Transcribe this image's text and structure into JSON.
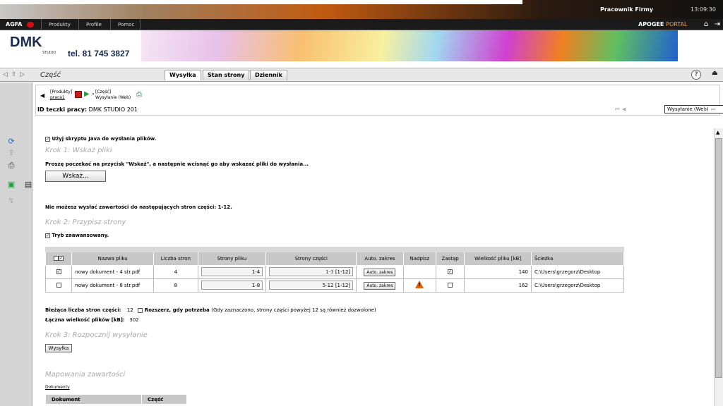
{
  "topbar": {
    "user": "Pracownik Firmy",
    "clock": "13:09:30"
  },
  "menubar": {
    "brand": "AGFA",
    "items": [
      "Produkty",
      "Profile",
      "Pomoc"
    ],
    "portal_main": "APOGEE",
    "portal_sub": "PORTAL",
    "icons": [
      "home-icon",
      "logout-icon"
    ]
  },
  "banner": {
    "logo": "DMK",
    "logo_sub": "STUDIO",
    "phone": "tel. 81 745 3827"
  },
  "tabs_row": {
    "title": "Część",
    "tabs": [
      "Wysyłka",
      "Stan strony",
      "Dziennik"
    ],
    "active": "Wysyłka",
    "help": "?"
  },
  "info": {
    "breadcrumb_1_top": "[Produkty]",
    "breadcrumb_1_bottom": "praca1",
    "breadcrumb_2_top": "[Część]",
    "breadcrumb_2_bottom": "Wysyłanie (Web)",
    "job_id_label": "ID teczki pracy:",
    "job_id_value": "DMK STUDIO 201",
    "dropdown_value": "Wysyłanie (Web)"
  },
  "main": {
    "java_label": "Użyj skryptu Java do wysłania plików.",
    "step1": "Krok 1: Wskaż pliki",
    "step1_instructions": "Proszę poczekać na przycisk \"Wskaż\", a następnie wcisnąć go aby wskazać pliki do wysłania...",
    "browse_button": "Wskaż...",
    "cannot_send": "Nie możesz wysłać zawartości do następujących stron części: 1-12.",
    "step2": "Krok 2: Przypisz strony",
    "advanced_label": "Tryb zaawansowany.",
    "table_headers": [
      "",
      "Nazwa pliku",
      "Liczba stron",
      "Strony pliku",
      "Strony części",
      "Auto. zakres",
      "Nadpisz",
      "Zastąp",
      "Wielkość pliku [kB]",
      "Ścieżka"
    ],
    "rows": [
      {
        "checked": true,
        "name": "nowy dokument - 4 str.pdf",
        "pages": "4",
        "file_pages": "1-4",
        "part_pages": "1-3",
        "part_range": "[1-12]",
        "auto": "Auto. zakres",
        "overwrite_warning": false,
        "replace": true,
        "size": "140",
        "path": "C:\\Users\\grzegorz\\Desktop"
      },
      {
        "checked": false,
        "name": "nowy dokument - 8 str.pdf",
        "pages": "8",
        "file_pages": "1-8",
        "part_pages": "5-12",
        "part_range": "[1-12]",
        "auto": "Auto. zakres",
        "overwrite_warning": true,
        "replace": false,
        "size": "162",
        "path": "C:\\Users\\grzegorz\\Desktop"
      }
    ],
    "current_pages_label": "Bieżąca liczba stron części:",
    "current_pages_value": "12",
    "extend_label": "Rozszerz, gdy potrzeba",
    "extend_note": "(Gdy zaznaczono, strony części powyżej 12 są również dozwolone)",
    "total_size_label": "Łączna wielkość plików [kB]:",
    "total_size_value": "302",
    "step3": "Krok 3: Rozpocznij wysyłanie",
    "send_button": "Wysyłka",
    "mapping_title": "Mapowania zawartości",
    "mapping_link": "Dokumenty",
    "mapping_headers": [
      "Dokument",
      "Część"
    ]
  },
  "colors": {
    "accent": "#f0a040",
    "warning": "#e06010",
    "red_text": "#d00000",
    "step_gray": "#aaaaaa"
  }
}
